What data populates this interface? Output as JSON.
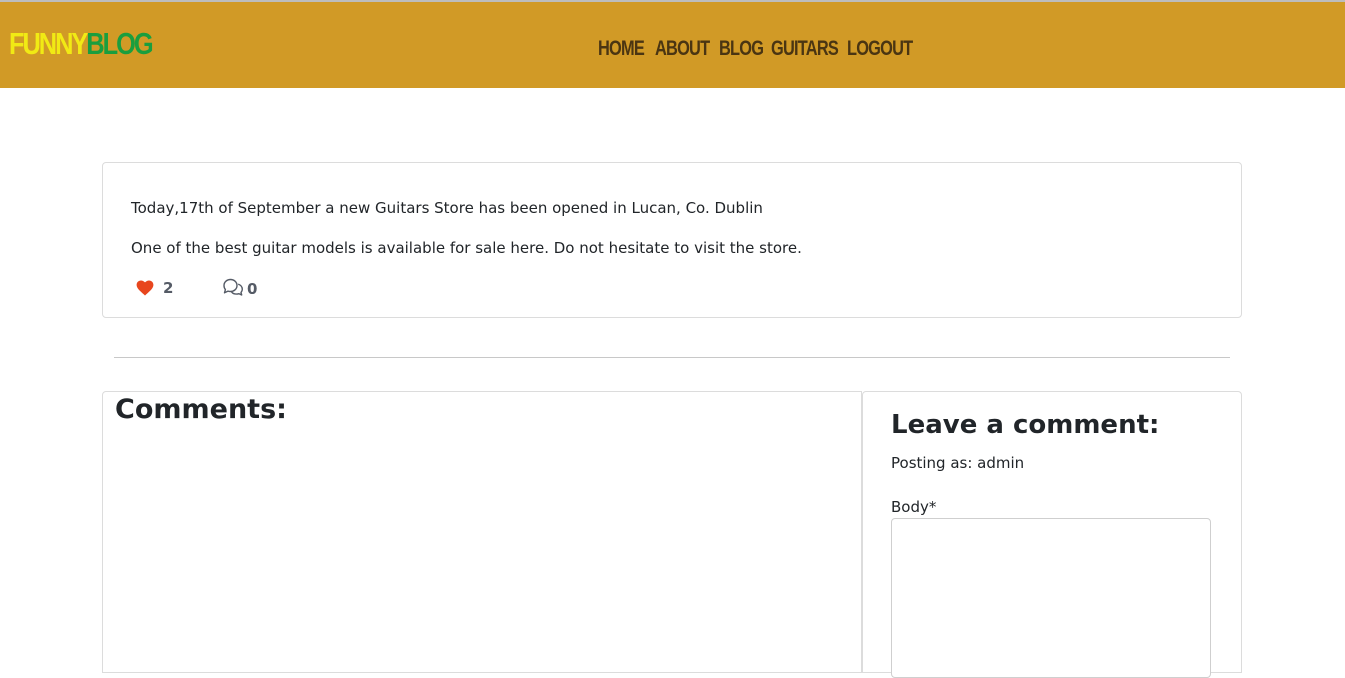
{
  "brand": {
    "part1": "FUNNY",
    "part2": "BLOG"
  },
  "nav": {
    "home": "HOME",
    "about": "ABOUT",
    "blog": "BLOG",
    "guitars": "GUITARS",
    "logout": "LOGOUT"
  },
  "post": {
    "paragraph1": "Today,17th of September a new Guitars Store has been opened in Lucan, Co. Dublin",
    "paragraph2": "One of the best guitar models is available for sale here. Do not hesitate to visit the store.",
    "likes": "2",
    "comments": "0",
    "like_icon": "heart-icon",
    "comment_icon": "chat-bubbles-icon"
  },
  "comments_section": {
    "title": "Comments:"
  },
  "comment_form": {
    "title": "Leave a comment:",
    "posting_as": "Posting as: admin",
    "body_label": "Body*",
    "body_value": ""
  },
  "colors": {
    "navbar": "#d19a26",
    "brand_yellow": "#f1ea14",
    "brand_green": "#1a9e3e",
    "nav_text": "#4a3512",
    "heart": "#e8461e"
  }
}
